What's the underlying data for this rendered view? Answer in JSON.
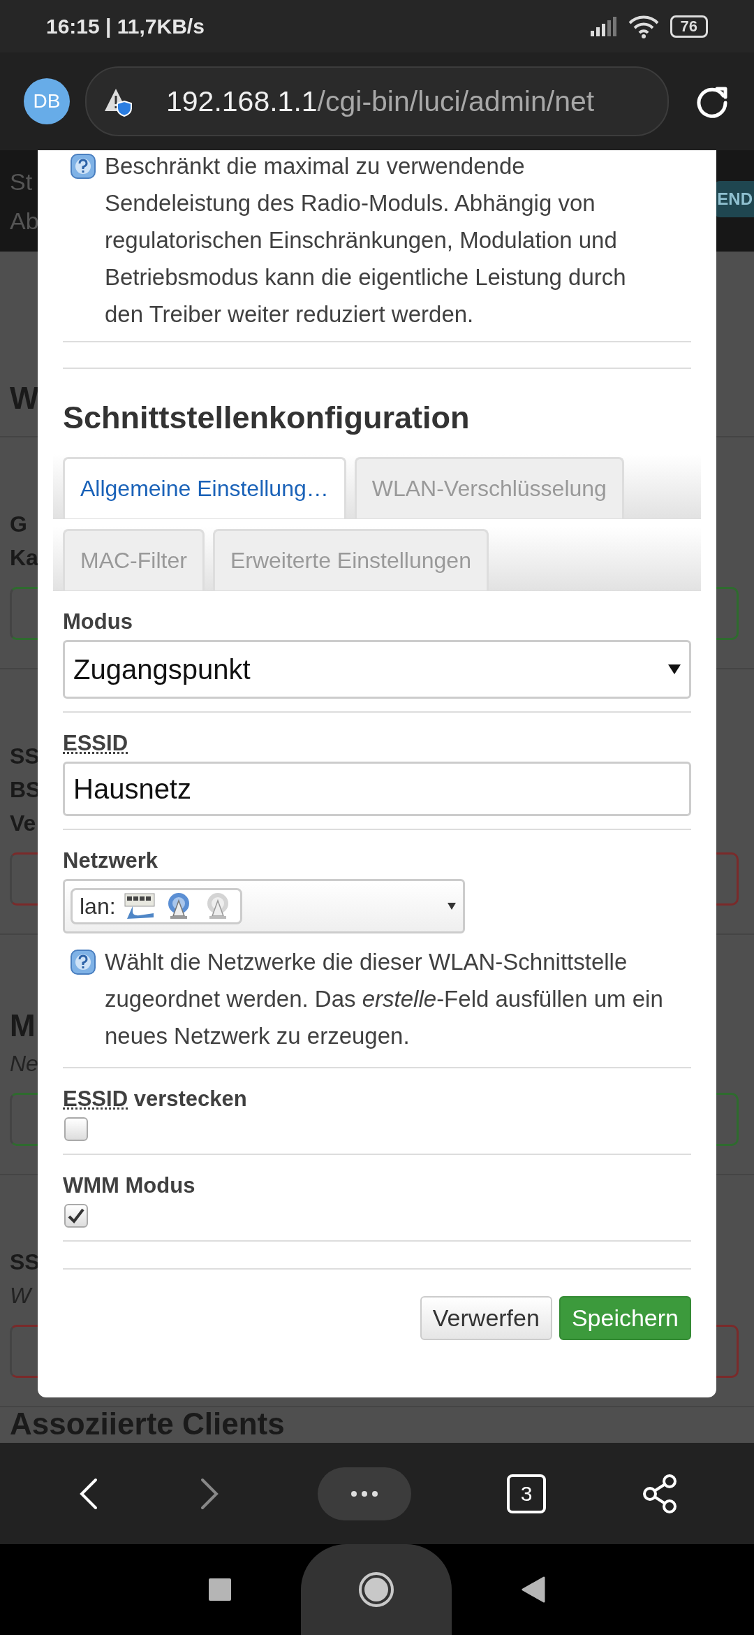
{
  "status_bar": {
    "time_speed": "16:15 | 11,7KB/s",
    "battery": "76"
  },
  "browser": {
    "avatar": "DB",
    "url_host": "192.168.1.1",
    "url_path": "/cgi-bin/luci/admin/net",
    "tab_count": "3"
  },
  "background_page": {
    "top_lines": [
      "St",
      "Ab"
    ],
    "top_button": "END",
    "sections": [
      {
        "items": [
          {
            "kind": "heading",
            "text": "W"
          }
        ]
      },
      {
        "items": [
          {
            "kind": "label",
            "text": "G"
          },
          {
            "kind": "label",
            "text": "Ka"
          },
          {
            "kind": "button",
            "color": "#2e6b2e"
          }
        ]
      },
      {
        "items": [
          {
            "kind": "label",
            "text": "SS"
          },
          {
            "kind": "label",
            "text": "BS"
          },
          {
            "kind": "label",
            "text": "Ve"
          },
          {
            "kind": "button",
            "color": "#7a2a2a"
          }
        ]
      },
      {
        "items": [
          {
            "kind": "heading",
            "text": "M"
          },
          {
            "kind": "note",
            "text": "Ne"
          },
          {
            "kind": "button",
            "color": "#2e6b2e"
          }
        ]
      },
      {
        "items": [
          {
            "kind": "label",
            "text": "SS"
          },
          {
            "kind": "note",
            "text": "W"
          },
          {
            "kind": "button",
            "color": "#7a2a2a"
          }
        ]
      },
      {
        "items": [
          {
            "kind": "heading",
            "text": "Assoziierte Clients"
          }
        ]
      }
    ]
  },
  "dialog": {
    "top_help": "Beschränkt die maximal zu verwendende Sendeleistung des Radio-Moduls. Abhängig von regulatorischen Einschränkungen, Modulation und Betriebsmodus kann die eigentliche Leistung durch den Treiber weiter reduziert werden.",
    "title": "Schnittstellenkonfiguration",
    "tab_rows": [
      [
        {
          "label": "Allgemeine Einstellung…",
          "selected": true
        },
        {
          "label": "WLAN-Verschlüsselung",
          "selected": false
        }
      ],
      [
        {
          "label": "MAC-Filter",
          "selected": false
        },
        {
          "label": "Erweiterte Einstellungen",
          "selected": false
        }
      ]
    ],
    "fields": [
      {
        "kind": "select",
        "label": "Modus",
        "value": "Zugangspunkt"
      },
      {
        "kind": "text",
        "label": "ESSID",
        "value": "Hausnetz"
      },
      {
        "kind": "network",
        "label": "Netzwerk",
        "value": "lan:",
        "help": "Wählt die Netzwerke die dieser WLAN-Schnittstelle zugeordnet werden. Das *erstelle*-Feld ausfüllen um ein neues Netzwerk zu erzeugen."
      },
      {
        "kind": "checkbox",
        "label": "ESSID",
        "label_rest": "verstecken",
        "checked": false
      },
      {
        "kind": "checkbox",
        "label": "WMM Modus",
        "checked": true
      }
    ],
    "buttons": [
      {
        "kind": "secondary",
        "label": "Verwerfen"
      },
      {
        "kind": "primary",
        "label": "Speichern"
      }
    ]
  }
}
